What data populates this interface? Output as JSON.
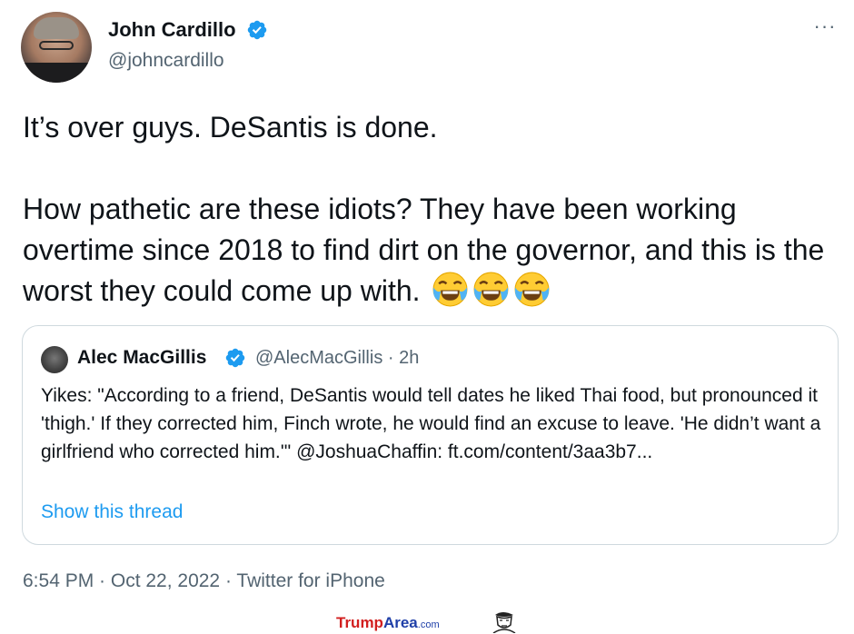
{
  "tweet": {
    "author_name": "John Cardillo",
    "handle": "@johncardillo",
    "text": "It’s over guys. DeSantis is done.\n\nHow pathetic are these idiots? They have been working overtime since 2018 to find dirt on the governor, and this is the worst they could come up with.",
    "emoji": "😂😂😂",
    "more_label": "···",
    "footer": "6:54 PM · Oct 22, 2022 · Twitter for iPhone"
  },
  "quote": {
    "author_name": "Alec MacGillis",
    "handle": "@AlecMacGillis",
    "time": "2h",
    "separator": "·",
    "text": "Yikes: \"According to a friend, DeSantis would tell dates he liked Thai food, but pronounced it 'thigh.' If they corrected him, Finch wrote, he would find an excuse to leave. 'He didn’t want a girlfriend who corrected him.'\" @JoshuaChaffin: ft.com/content/3aa3b7...",
    "show_thread": "Show this thread"
  },
  "watermark": {
    "part1": "Trump",
    "part2": "Area",
    "part3": ".com"
  },
  "colors": {
    "verified": "#1d9bf0",
    "link": "#1d9bf0",
    "secondary_text": "#536471",
    "border": "#cfd9de"
  },
  "icons": [
    "verified-badge-icon",
    "more-options-icon",
    "laughing-emoji-icon",
    "watermark-logo-icon"
  ]
}
